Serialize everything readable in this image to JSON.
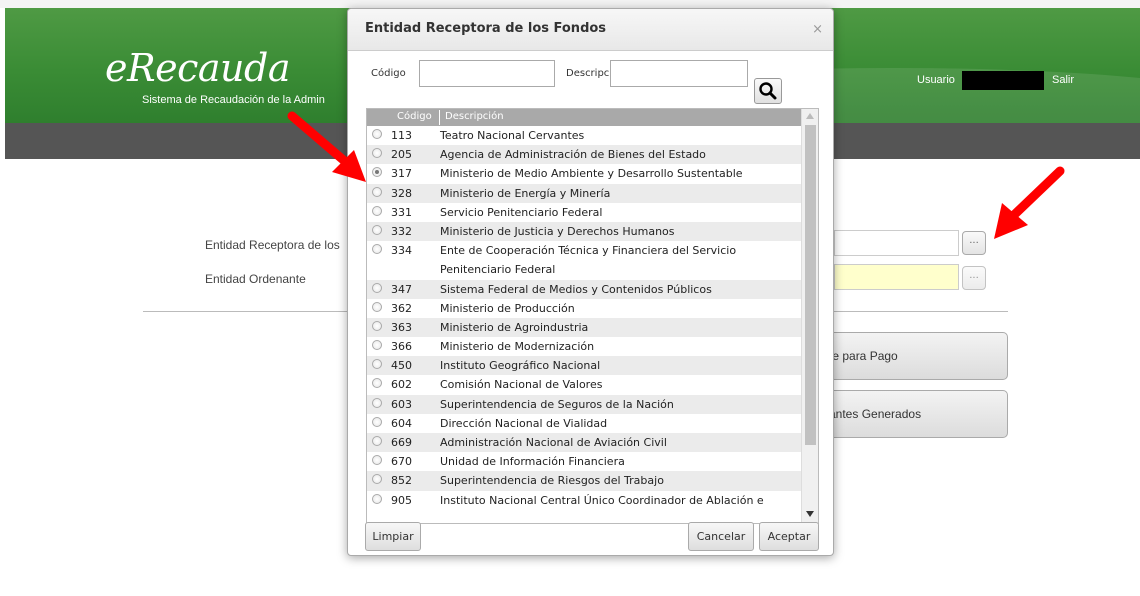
{
  "app": {
    "logo": "eRecauda",
    "subtitle": "Sistema de Recaudación de la Admin",
    "user_label": "Usuario",
    "logout": "Salir"
  },
  "form": {
    "entidad_receptora_label": "Entidad Receptora de los",
    "entidad_ordenante_label": "Entidad Ordenante",
    "dots": "...",
    "btn_comprobante": "te para Pago",
    "btn_generados": "antes Generados"
  },
  "modal": {
    "title": "Entidad Receptora de los Fondos",
    "close": "×",
    "codigo_label": "Código",
    "descripcion_label": "Descripci",
    "codigo_value": "",
    "descripcion_value": "",
    "col_codigo": "Código",
    "col_descripcion": "Descripción",
    "rows": [
      {
        "code": "113",
        "desc": "Teatro Nacional Cervantes",
        "checked": false
      },
      {
        "code": "205",
        "desc": "Agencia de Administración de Bienes del Estado",
        "checked": false
      },
      {
        "code": "317",
        "desc": "Ministerio de Medio Ambiente y Desarrollo Sustentable",
        "checked": true
      },
      {
        "code": "328",
        "desc": "Ministerio de Energía y Minería",
        "checked": false
      },
      {
        "code": "331",
        "desc": "Servicio Penitenciario Federal",
        "checked": false
      },
      {
        "code": "332",
        "desc": "Ministerio de Justicia y Derechos Humanos",
        "checked": false
      },
      {
        "code": "334",
        "desc": "Ente de Cooperación Técnica y Financiera del Servicio Penitenciario Federal",
        "checked": false,
        "tall": true
      },
      {
        "code": "347",
        "desc": "Sistema Federal de Medios y Contenidos Públicos",
        "checked": false
      },
      {
        "code": "362",
        "desc": "Ministerio de Producción",
        "checked": false
      },
      {
        "code": "363",
        "desc": "Ministerio de Agroindustria",
        "checked": false
      },
      {
        "code": "366",
        "desc": "Ministerio de Modernización",
        "checked": false
      },
      {
        "code": "450",
        "desc": "Instituto Geográfico Nacional",
        "checked": false
      },
      {
        "code": "602",
        "desc": "Comisión Nacional de Valores",
        "checked": false
      },
      {
        "code": "603",
        "desc": "Superintendencia de Seguros de la Nación",
        "checked": false
      },
      {
        "code": "604",
        "desc": "Dirección Nacional de Vialidad",
        "checked": false
      },
      {
        "code": "669",
        "desc": "Administración Nacional de Aviación Civil",
        "checked": false
      },
      {
        "code": "670",
        "desc": "Unidad de Información Financiera",
        "checked": false
      },
      {
        "code": "852",
        "desc": "Superintendencia de Riesgos del Trabajo",
        "checked": false
      },
      {
        "code": "905",
        "desc": "Instituto Nacional Central Único Coordinador de Ablación e",
        "checked": false
      }
    ],
    "btn_limpiar": "Limpiar",
    "btn_cancelar": "Cancelar",
    "btn_aceptar": "Aceptar"
  },
  "colors": {
    "banner_green": "#3a8c35",
    "navbar_gray": "#555555",
    "annotation_red": "#ff0000",
    "header_gray": "#a9a9a9"
  }
}
